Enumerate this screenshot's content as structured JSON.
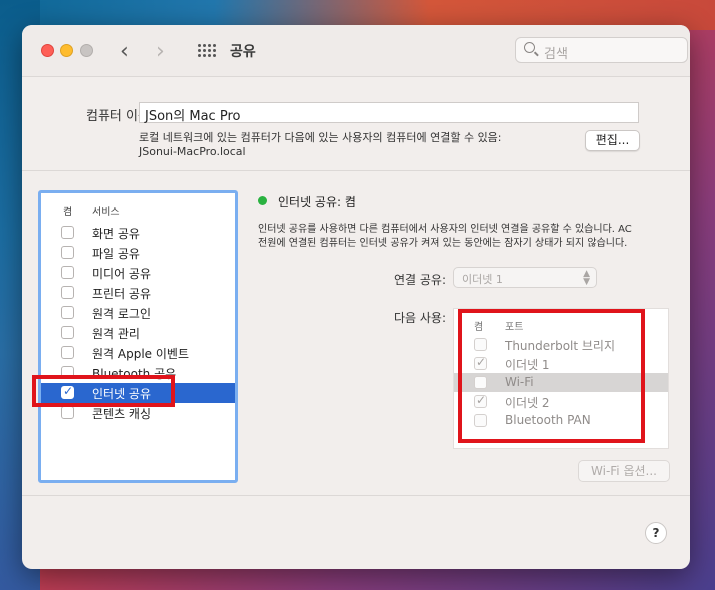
{
  "window": {
    "title": "공유",
    "search_placeholder": "검색"
  },
  "computer_name": {
    "label": "컴퓨터 이름:",
    "value": "JSon의 Mac Pro",
    "description": "로컬 네트워크에 있는 컴퓨터가 다음에 있는 사용자의 컴퓨터에 연결할 수 있음:",
    "hostname": "JSonui-MacPro.local",
    "edit_label": "편집..."
  },
  "services": {
    "header_on": "켬",
    "header_service": "서비스",
    "items": [
      {
        "label": "화면 공유",
        "checked": false,
        "selected": false
      },
      {
        "label": "파일 공유",
        "checked": false,
        "selected": false
      },
      {
        "label": "미디어 공유",
        "checked": false,
        "selected": false
      },
      {
        "label": "프린터 공유",
        "checked": false,
        "selected": false
      },
      {
        "label": "원격 로그인",
        "checked": false,
        "selected": false
      },
      {
        "label": "원격 관리",
        "checked": false,
        "selected": false
      },
      {
        "label": "원격 Apple 이벤트",
        "checked": false,
        "selected": false
      },
      {
        "label": "Bluetooth 공유",
        "checked": false,
        "selected": false
      },
      {
        "label": "인터넷 공유",
        "checked": true,
        "selected": true
      },
      {
        "label": "콘텐츠 캐싱",
        "checked": false,
        "selected": false
      }
    ]
  },
  "detail": {
    "status": "인터넷 공유: 켬",
    "status_color": "#2ab240",
    "description_line1": "인터넷 공유를 사용하면 다른 컴퓨터에서 사용자의 인터넷 연결을 공유할 수 있습니다. AC",
    "description_line2": "전원에 연결된 컴퓨터는 인터넷 공유가 켜져 있는 동안에는 잠자기 상태가 되지 않습니다.",
    "share_from_label": "연결 공유:",
    "share_from_value": "이더넷 1",
    "to_label": "다음 사용:",
    "ports_header_on": "켬",
    "ports_header_port": "포트",
    "ports": [
      {
        "label": "Thunderbolt 브리지",
        "checked": false,
        "highlight": false
      },
      {
        "label": "이더넷 1",
        "checked": true,
        "highlight": false
      },
      {
        "label": "Wi-Fi",
        "checked": false,
        "highlight": true
      },
      {
        "label": "이더넷 2",
        "checked": true,
        "highlight": false
      },
      {
        "label": "Bluetooth PAN",
        "checked": false,
        "highlight": false
      }
    ],
    "wifi_options_label": "Wi-Fi 옵션...",
    "help_label": "?"
  },
  "colors": {
    "selection": "#2a67cf",
    "annotation_red": "#e0141b"
  }
}
